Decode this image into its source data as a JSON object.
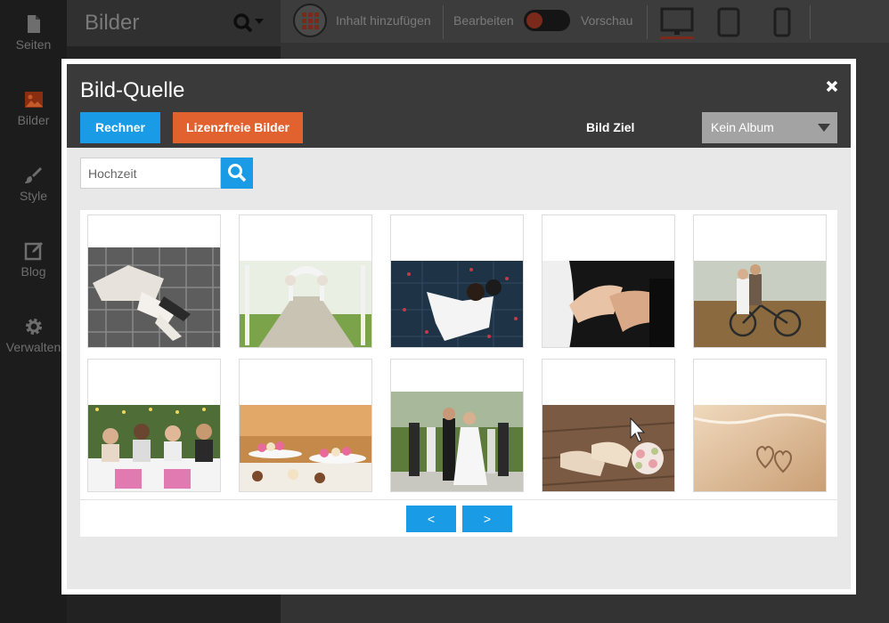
{
  "rail": {
    "items": [
      {
        "label": "Seiten",
        "icon": "page-icon"
      },
      {
        "label": "Bilder",
        "icon": "image-icon"
      },
      {
        "label": "Style",
        "icon": "brush-icon"
      },
      {
        "label": "Blog",
        "icon": "edit-icon"
      },
      {
        "label": "Verwalten",
        "icon": "gear-icon"
      }
    ]
  },
  "panel2": {
    "title": "Bilder"
  },
  "toolbar": {
    "add_label": "Inhalt hinzufügen",
    "edit_label": "Bearbeiten",
    "preview_label": "Vorschau"
  },
  "modal": {
    "title": "Bild-Quelle",
    "btn_rechner": "Rechner",
    "btn_lizenz": "Lizenzfreie Bilder",
    "ziel_label": "Bild Ziel",
    "album_value": "Kein Album",
    "search_value": "Hochzeit",
    "prev_label": "<",
    "next_label": ">"
  },
  "colors": {
    "accent_blue": "#1a9be6",
    "accent_orange": "#e2622f",
    "header_dark": "#3a3a3a"
  },
  "thumbnails": [
    {
      "name": "smashed-cake-figurine"
    },
    {
      "name": "garden-aisle-arch"
    },
    {
      "name": "couple-petals-overhead"
    },
    {
      "name": "ring-on-hand"
    },
    {
      "name": "couple-bicycle-field"
    },
    {
      "name": "party-friends-table"
    },
    {
      "name": "cupcake-dessert-table"
    },
    {
      "name": "couple-guests-cake"
    },
    {
      "name": "bridal-shoes-bouquet"
    },
    {
      "name": "hearts-in-sand"
    }
  ]
}
